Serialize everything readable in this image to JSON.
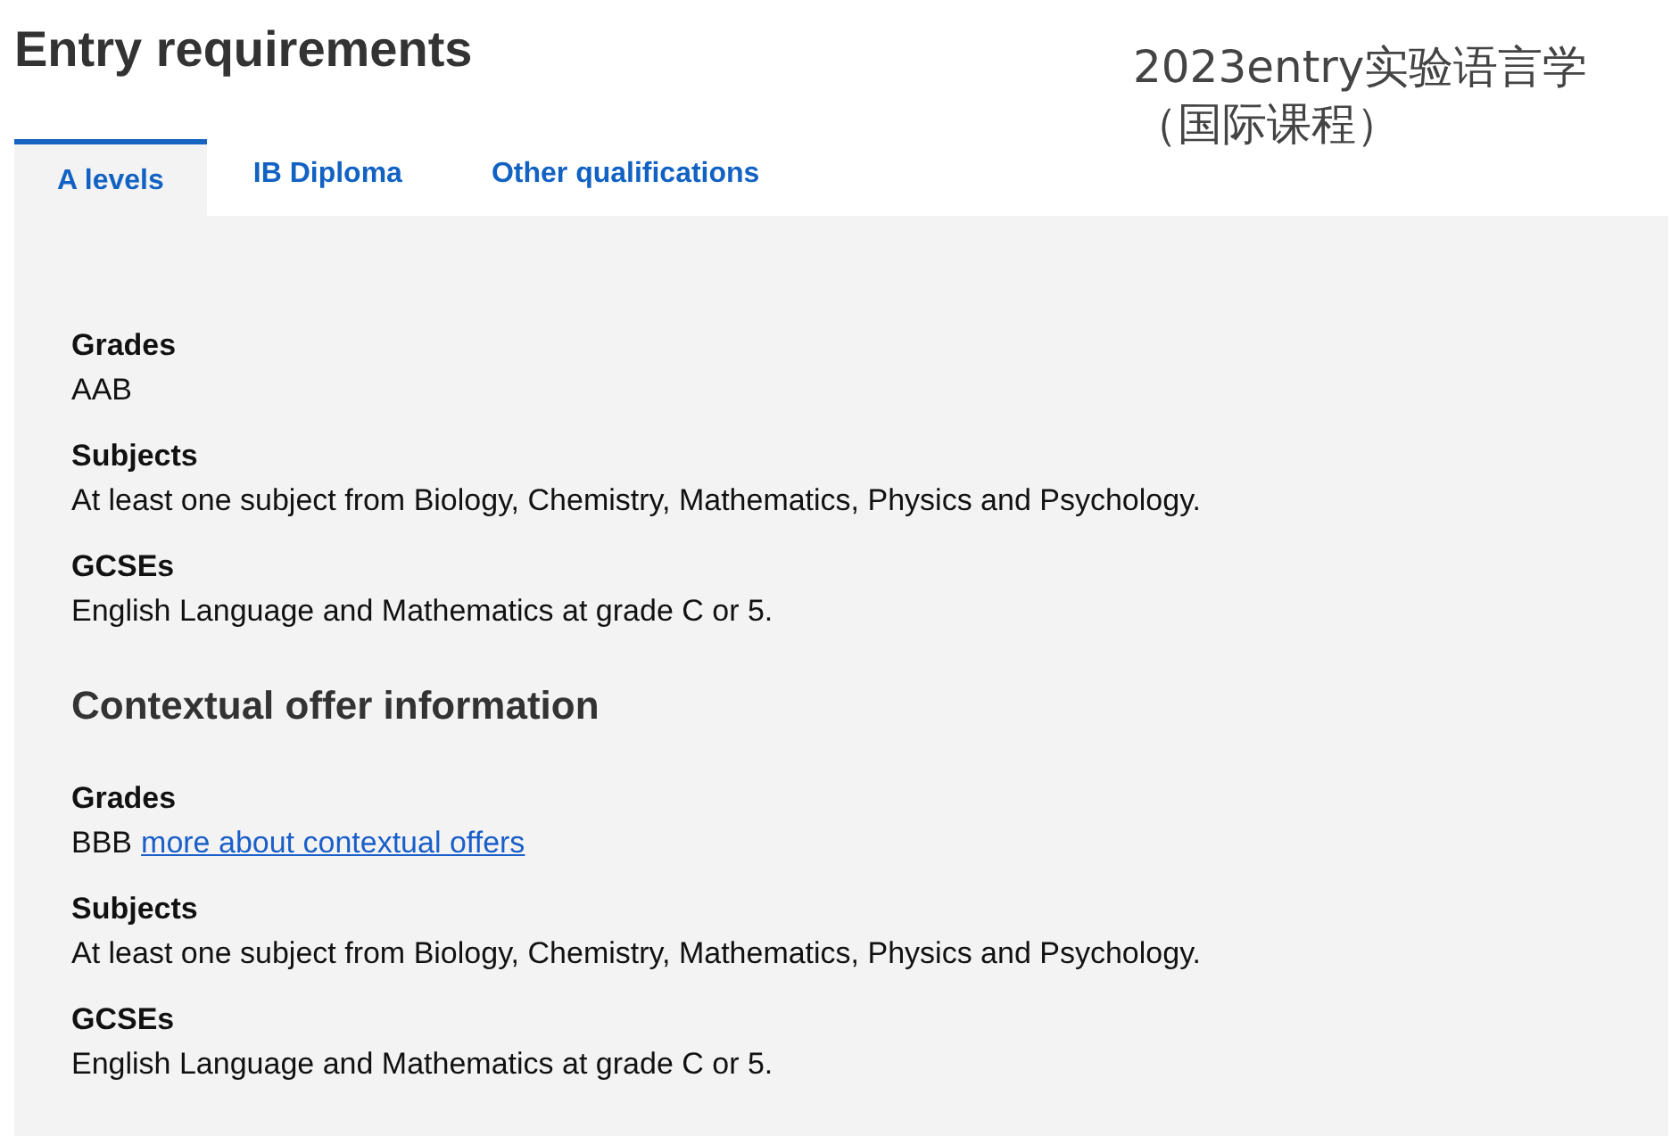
{
  "title": "Entry requirements",
  "annotation": "2023entry实验语言学（国际课程）",
  "tabs": [
    {
      "label": "A levels",
      "selected": true
    },
    {
      "label": "IB Diploma",
      "selected": false
    },
    {
      "label": "Other qualifications",
      "selected": false
    }
  ],
  "sections": [
    {
      "items": [
        {
          "label": "Grades",
          "text": "AAB"
        },
        {
          "label": "Subjects",
          "text": "At least one subject from Biology, Chemistry, Mathematics, Physics and Psychology."
        },
        {
          "label": "GCSEs",
          "text": "English Language and Mathematics at grade C or 5."
        }
      ]
    },
    {
      "heading": "Contextual offer information",
      "items": [
        {
          "label": "Grades",
          "text": "BBB",
          "link": "more about contextual offers"
        },
        {
          "label": "Subjects",
          "text": "At least one subject from Biology, Chemistry, Mathematics, Physics and Psychology."
        },
        {
          "label": "GCSEs",
          "text": "English Language and Mathematics at grade C or 5."
        }
      ]
    }
  ]
}
